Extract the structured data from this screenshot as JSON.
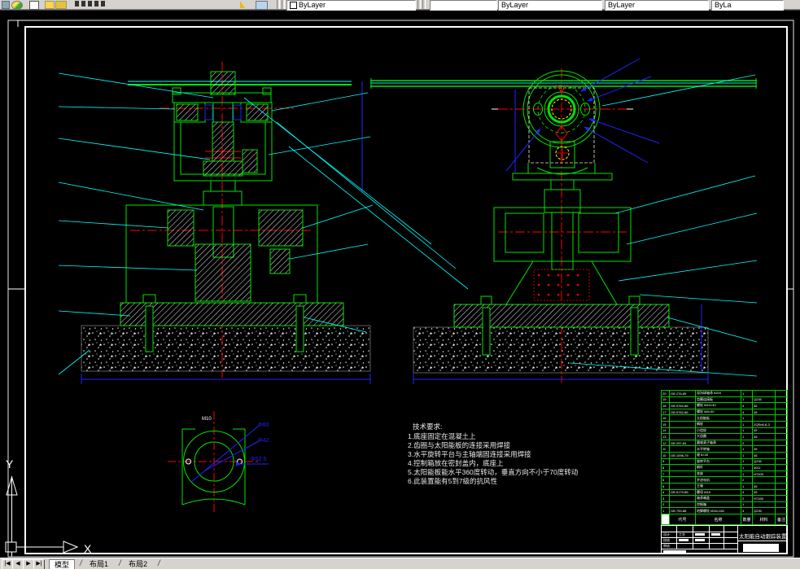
{
  "toolbar": {
    "combos": {
      "layer": "ByLayer",
      "color": "",
      "linetype": "ByLayer",
      "lineweight": "ByLayer",
      "plotstyle": "ByLa"
    }
  },
  "statusbar": {
    "nav": [
      "|◀",
      "◀",
      "▶",
      "▶|"
    ],
    "tabs": [
      "模型",
      "布局1",
      "布局2"
    ],
    "separator": "/"
  },
  "ucs": {
    "x_label": "X",
    "y_label": "Y"
  },
  "tech_requirements": {
    "title": "技术要求:",
    "items": [
      "1.底座固定在混凝土上",
      "2.齿圈与太阳能板的连接采用焊接",
      "3.水平旋转平台与主轴端固连接采用焊接",
      "4.控制箱放在密封盖内，底座上",
      "5.太阳能板能水平360度转动，垂直方向不小于70度转动",
      "6.此装置能有5到7级的抗风性"
    ]
  },
  "detail_view": {
    "thread_label": "M10",
    "dim_labels": [
      "Φ60",
      "Φ42",
      "Φ52.5"
    ]
  },
  "bom": {
    "headers": [
      "序号",
      "代号",
      "名称",
      "数量",
      "材料",
      "备注"
    ],
    "rows": [
      [
        "20",
        "GB 276-89",
        "深沟球轴承 6204",
        "1",
        "",
        ""
      ],
      [
        "19",
        "",
        "齿圈连接板",
        "1",
        "Q235",
        ""
      ],
      [
        "18",
        "GB 5782-86",
        "螺栓 M10×40",
        "4",
        "45",
        ""
      ],
      [
        "17",
        "GB 5782-86",
        "螺栓 M8×30",
        "4",
        "45",
        ""
      ],
      [
        "16",
        "",
        "太阳能板",
        "1",
        "",
        ""
      ],
      [
        "15",
        "",
        "蜗轮",
        "1",
        "ZQSn6-6-3",
        ""
      ],
      [
        "14",
        "",
        "小齿轮",
        "1",
        "45",
        ""
      ],
      [
        "13",
        "",
        "大齿圈",
        "1",
        "45",
        ""
      ],
      [
        "12",
        "GB 297-84",
        "圆锥滚子轴承",
        "2",
        "",
        ""
      ],
      [
        "11",
        "",
        "水平转轴",
        "1",
        "45",
        ""
      ],
      [
        "10",
        "GB 1096-79",
        "键 8×35",
        "1",
        "45",
        ""
      ],
      [
        "9",
        "",
        "旋转平台",
        "1",
        "Q235",
        ""
      ],
      [
        "8",
        "",
        "蜗杆",
        "1",
        "40Cr",
        ""
      ],
      [
        "7",
        "",
        "底座",
        "1",
        "HT200",
        ""
      ],
      [
        "6",
        "",
        "步进电机",
        "2",
        "",
        ""
      ],
      [
        "5",
        "",
        "主轴",
        "1",
        "45",
        ""
      ],
      [
        "4",
        "GB 6170-86",
        "螺母 M16",
        "4",
        "45",
        ""
      ],
      [
        "3",
        "",
        "轴承端盖",
        "2",
        "HT150",
        ""
      ],
      [
        "2",
        "",
        "控制箱",
        "1",
        "",
        ""
      ],
      [
        "1",
        "GB 799-88",
        "地脚螺栓 M16×160",
        "4",
        "Q235",
        ""
      ]
    ]
  },
  "title_block": {
    "title": "太阳能自动跟踪装置",
    "fields": [
      "设计",
      "校核",
      "审核",
      "工艺"
    ]
  },
  "colors": {
    "background": "#000000",
    "chrome": "#d6d3ce",
    "line_green": "#00e400",
    "line_cyan": "#00ffff",
    "line_red": "#ff0000",
    "line_blue": "#2222ff",
    "line_white": "#ffffff"
  }
}
